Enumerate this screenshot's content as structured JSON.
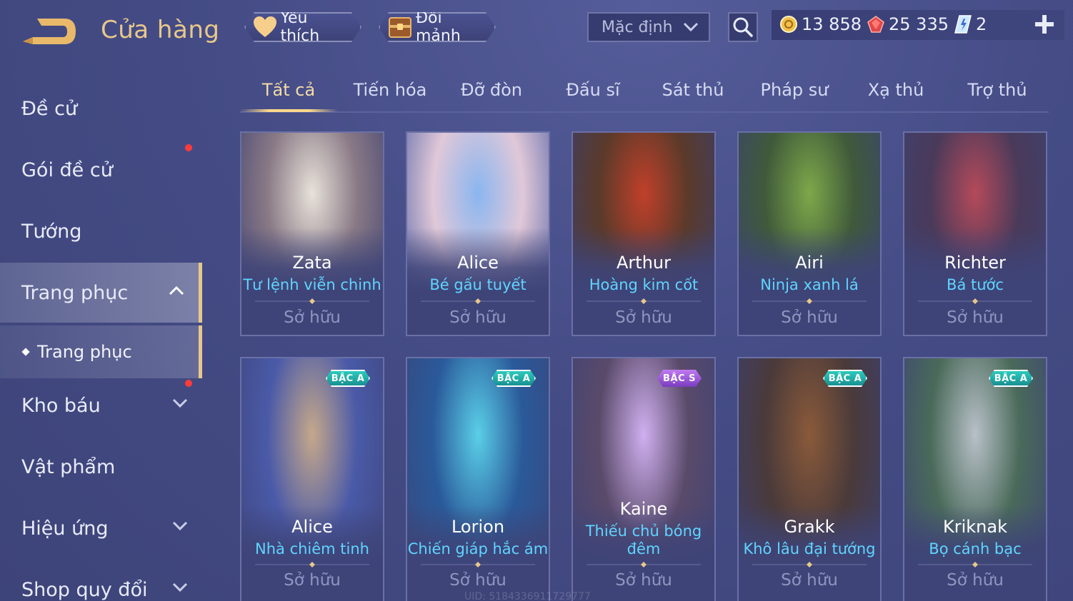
{
  "header": {
    "title": "Cửa hàng",
    "favorites_label": "Yêu thích",
    "fragments_label": "Đổi mảnh",
    "sort_value": "Mặc định",
    "currencies": [
      {
        "name": "gold",
        "icon": "gold-coin-icon",
        "value": "13 858"
      },
      {
        "name": "ruby",
        "icon": "ruby-icon",
        "value": "25 335"
      },
      {
        "name": "voucher",
        "icon": "voucher-icon",
        "value": "2"
      }
    ]
  },
  "sidebar": {
    "items": [
      {
        "label": "Đề cử"
      },
      {
        "label": "Gói đề cử",
        "notification": true
      },
      {
        "label": "Tướng"
      },
      {
        "label": "Trang phục",
        "expanded": true,
        "active": true
      },
      {
        "label": "Trang phục",
        "sub": true
      },
      {
        "label": "Kho báu",
        "notification": true
      },
      {
        "label": "Vật phẩm"
      },
      {
        "label": "Hiệu ứng"
      },
      {
        "label": "Shop quy đổi"
      }
    ]
  },
  "tabs": [
    {
      "label": "Tất cả",
      "active": true
    },
    {
      "label": "Tiến hóa"
    },
    {
      "label": "Đỡ đòn"
    },
    {
      "label": "Đấu sĩ"
    },
    {
      "label": "Sát thủ"
    },
    {
      "label": "Pháp sư"
    },
    {
      "label": "Xạ thủ"
    },
    {
      "label": "Trợ thủ"
    }
  ],
  "cards": [
    {
      "hero": "Zata",
      "skin": "Tư lệnh viễn chinh",
      "status": "Sở hữu",
      "tier": ""
    },
    {
      "hero": "Alice",
      "skin": "Bé gấu tuyết",
      "status": "Sở hữu",
      "tier": ""
    },
    {
      "hero": "Arthur",
      "skin": "Hoàng kim cốt",
      "status": "Sở hữu",
      "tier": ""
    },
    {
      "hero": "Airi",
      "skin": "Ninja xanh lá",
      "status": "Sở hữu",
      "tier": ""
    },
    {
      "hero": "Richter",
      "skin": "Bá tước",
      "status": "Sở hữu",
      "tier": ""
    },
    {
      "hero": "Alice",
      "skin": "Nhà chiêm tinh",
      "status": "Sở hữu",
      "tier": "BẬC A"
    },
    {
      "hero": "Lorion",
      "skin": "Chiến giáp hắc ám",
      "status": "Sở hữu",
      "tier": "BẬC A"
    },
    {
      "hero": "Kaine",
      "skin": "Thiếu chủ bóng đêm",
      "status": "Sở hữu",
      "tier": "BẬC S"
    },
    {
      "hero": "Grakk",
      "skin": "Khô lâu đại tướng",
      "status": "Sở hữu",
      "tier": "BẬC A"
    },
    {
      "hero": "Kriknak",
      "skin": "Bọ cánh bạc",
      "status": "Sở hữu",
      "tier": "BẬC A"
    }
  ],
  "footer": {
    "uid": "UID: 5184336911729777"
  },
  "colors": {
    "accent_gold": "#e8c88a",
    "skin_name": "#5fd5ff",
    "notification": "#ff3b3b",
    "tier_a": "#2fd0c0",
    "tier_s": "#c07af0"
  }
}
